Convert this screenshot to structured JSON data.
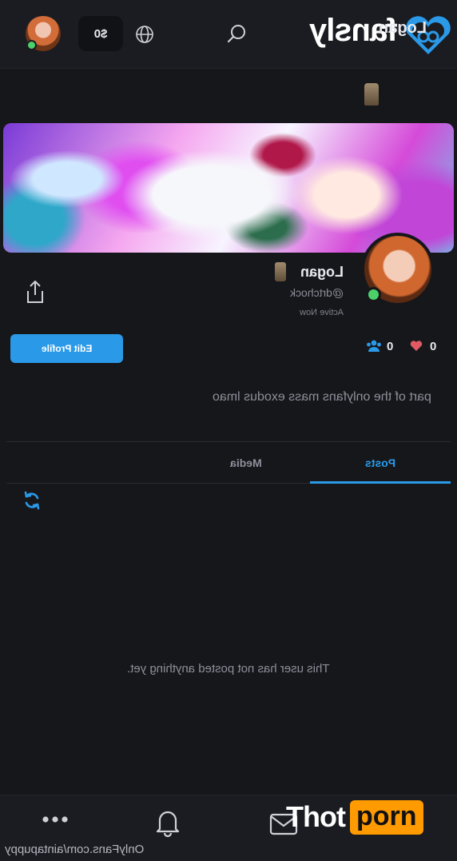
{
  "topbar": {
    "balance": "$0",
    "brand": "fansly",
    "brand_color": "#2a9ae8"
  },
  "profile": {
    "page_name": "Logan",
    "display_name": "Logan",
    "handle": "@drtchock",
    "status": "Active Now",
    "edit_button": "Edit Profile",
    "followers": "0",
    "likes": "0",
    "bio": "part of the onlyfans mass exodus lmao",
    "online_color": "#4bd06a"
  },
  "tabs": {
    "posts": "Posts",
    "media": "Media"
  },
  "empty_message": "This user has not posted anything yet.",
  "watermark": {
    "url": "OnlyFans.com/aintapuppy",
    "thot": "Thot",
    "porn": "porn",
    "porn_color": "#ff9a00"
  }
}
